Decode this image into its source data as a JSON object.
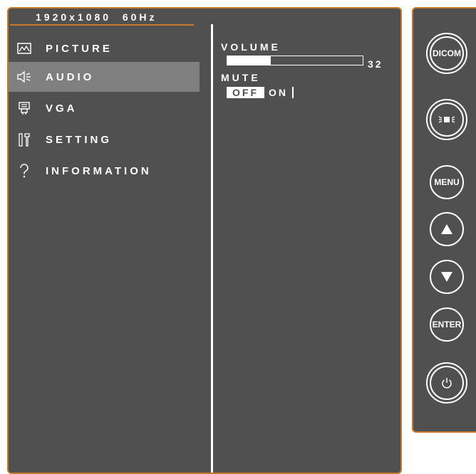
{
  "osd": {
    "resolution": "1920x1080  60Hz",
    "menu": [
      {
        "label": "PICTURE",
        "icon": "picture-icon"
      },
      {
        "label": "AUDIO",
        "icon": "speaker-icon",
        "selected": true
      },
      {
        "label": "VGA",
        "icon": "vga-connector-icon"
      },
      {
        "label": "SETTING",
        "icon": "tools-icon"
      },
      {
        "label": "INFORMATION",
        "icon": "question-icon"
      }
    ],
    "audio": {
      "volume_label": "VOLUME",
      "volume_value": "32",
      "volume_level": 0.32,
      "mute_label": "MUTE",
      "mute_options": [
        "OFF",
        "ON"
      ],
      "mute_selected": "OFF"
    }
  },
  "keypad": {
    "dicom_label": "DICOM",
    "menu_label": "MENU",
    "enter_label": "ENTER",
    "brightness_icon": "brightness-icon",
    "up_icon": "up-arrow-icon",
    "down_icon": "down-arrow-icon",
    "power_icon": "power-icon"
  },
  "colors": {
    "panel": "#505050",
    "border": "#c8782a",
    "highlight": "#808080",
    "text": "#ffffff"
  }
}
